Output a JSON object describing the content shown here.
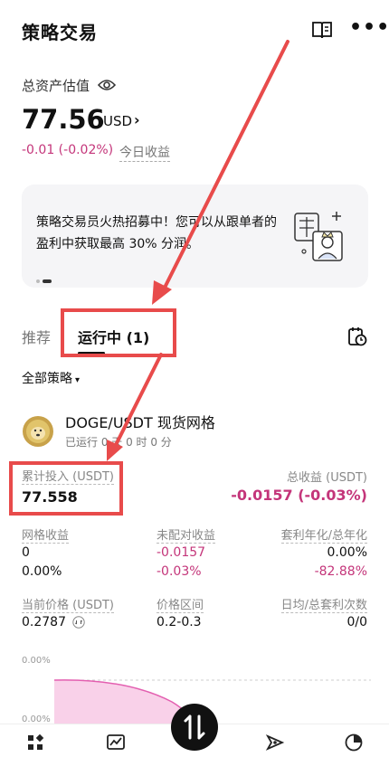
{
  "header": {
    "title": "策略交易",
    "book_icon": "book-icon",
    "more_label": "•••"
  },
  "assets": {
    "label": "总资产估值",
    "value": "77.56",
    "unit": "USD",
    "chevron": "›",
    "pnl": "-0.01 (-0.02%)",
    "pnl_label": "今日收益"
  },
  "banner": {
    "text": "策略交易员火热招募中！您可以从跟单者的盈利中获取最高 30% 分润。"
  },
  "tabs": [
    {
      "label": "推荐"
    },
    {
      "label": "运行中 (1)"
    }
  ],
  "filter": {
    "label": "全部策略",
    "caret": "▾"
  },
  "strategy": {
    "name": "DOGE/USDT 现货网格",
    "runtime": "已运行 0 天 0 时 0 分",
    "invest_label": "累计投入 (USDT)",
    "invest_value": "77.558",
    "profit_label": "总收益 (USDT)",
    "profit_value": "-0.0157 (-0.03%)",
    "grid_label": "网格收益",
    "grid_v1": "0",
    "grid_v2": "0.00%",
    "unmatched_label": "未配对收益",
    "unmatched_v1": "-0.0157",
    "unmatched_v2": "-0.03%",
    "annual_label": "套利年化/总年化",
    "annual_v1": "0.00%",
    "annual_v2": "-82.88%",
    "price_label": "当前价格 (USDT)",
    "price_value": "0.2787",
    "range_label": "价格区间",
    "range_value": "0.2-0.3",
    "count_label": "日均/总套利次数",
    "count_value": "0/0",
    "chart_y1": "0.00%",
    "chart_y2": "0.00%"
  },
  "colors": {
    "accent": "#c4357a",
    "highlight": "#e84b4b",
    "fill": "#f7c6e4"
  }
}
